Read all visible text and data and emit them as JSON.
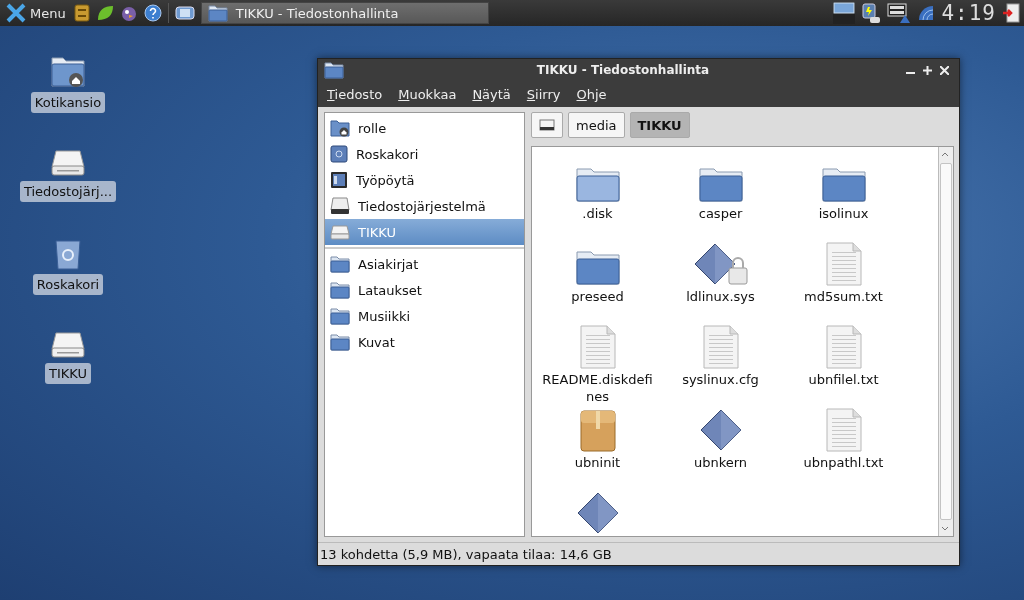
{
  "taskbar": {
    "menu_label": "Menu",
    "task_title": "TIKKU - Tiedostonhallinta",
    "clock": "4:19"
  },
  "desktop_icons": [
    {
      "kind": "home",
      "label": "Kotikansio"
    },
    {
      "kind": "drive",
      "label": "Tiedostojärj..."
    },
    {
      "kind": "trash",
      "label": "Roskakori"
    },
    {
      "kind": "removable",
      "label": "TIKKU"
    }
  ],
  "window": {
    "title": "TIKKU - Tiedostonhallinta",
    "menu": [
      "Tiedosto",
      "Muokkaa",
      "Näytä",
      "Siirry",
      "Ohje"
    ],
    "sidebar": {
      "places": [
        {
          "kind": "home",
          "label": "rolle",
          "selected": false
        },
        {
          "kind": "trash",
          "label": "Roskakori",
          "selected": false
        },
        {
          "kind": "desktop",
          "label": "Työpöytä",
          "selected": false
        },
        {
          "kind": "drive",
          "label": "Tiedostojärjestelmä",
          "selected": false
        },
        {
          "kind": "removable",
          "label": "TIKKU",
          "selected": true
        }
      ],
      "bookmarks": [
        {
          "kind": "folder",
          "label": "Asiakirjat",
          "selected": false
        },
        {
          "kind": "folder",
          "label": "Lataukset",
          "selected": false
        },
        {
          "kind": "folder",
          "label": "Musiikki",
          "selected": false
        },
        {
          "kind": "folder",
          "label": "Kuvat",
          "selected": false
        }
      ]
    },
    "path": [
      {
        "kind": "root",
        "selected": false
      },
      {
        "kind": "text",
        "label": "media",
        "selected": false
      },
      {
        "kind": "text",
        "label": "TIKKU",
        "selected": true
      }
    ],
    "files": [
      {
        "kind": "folder-light",
        "name": ".disk"
      },
      {
        "kind": "folder",
        "name": "casper"
      },
      {
        "kind": "folder",
        "name": "isolinux"
      },
      {
        "kind": "folder",
        "name": "preseed"
      },
      {
        "kind": "executable-locked",
        "name": "ldlinux.sys"
      },
      {
        "kind": "text",
        "name": "md5sum.txt"
      },
      {
        "kind": "text",
        "name": "README.diskdefines"
      },
      {
        "kind": "text",
        "name": "syslinux.cfg"
      },
      {
        "kind": "text",
        "name": "ubnfilel.txt"
      },
      {
        "kind": "package",
        "name": "ubninit"
      },
      {
        "kind": "executable",
        "name": "ubnkern"
      },
      {
        "kind": "text",
        "name": "ubnpathl.txt"
      },
      {
        "kind": "executable"
      }
    ],
    "status_bar": "13 kohdetta (5,9 MB), vapaata tilaa: 14,6 GB"
  }
}
